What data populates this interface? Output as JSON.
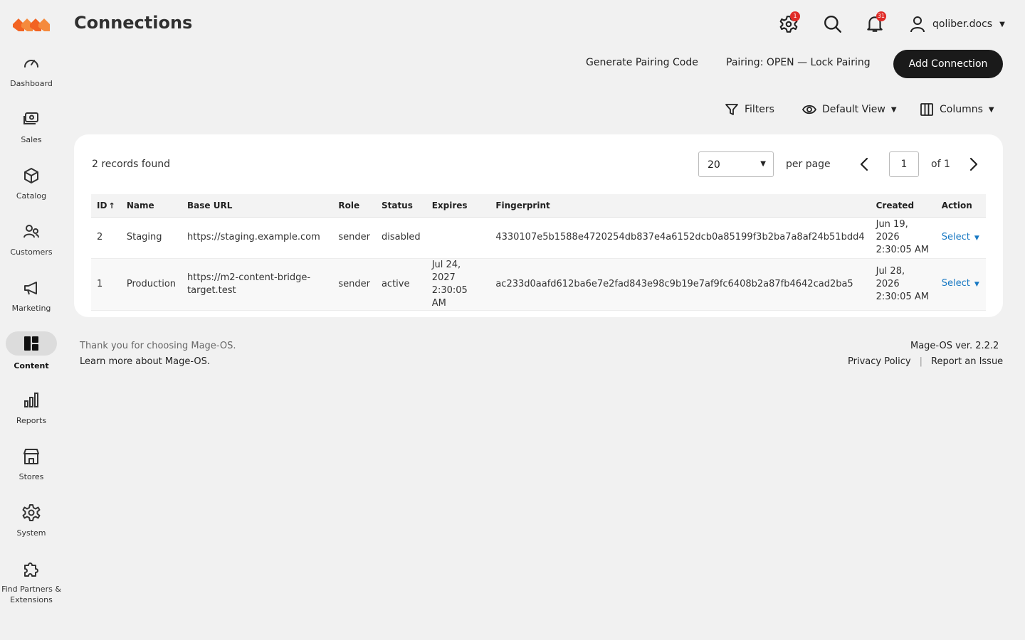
{
  "sidebar": {
    "logo": "mage-os-logo",
    "brand_color": "#f26322",
    "items": [
      {
        "label": "Dashboard",
        "icon": "speedometer-icon"
      },
      {
        "label": "Sales",
        "icon": "cash-icon"
      },
      {
        "label": "Catalog",
        "icon": "box-icon"
      },
      {
        "label": "Customers",
        "icon": "customers-icon"
      },
      {
        "label": "Marketing",
        "icon": "megaphone-icon"
      },
      {
        "label": "Content",
        "icon": "content-grid-icon",
        "active": true
      },
      {
        "label": "Reports",
        "icon": "bar-chart-icon"
      },
      {
        "label": "Stores",
        "icon": "storefront-icon"
      },
      {
        "label": "System",
        "icon": "gear-icon"
      },
      {
        "label": "Find Partners & Extensions",
        "icon": "puzzle-icon"
      }
    ]
  },
  "header": {
    "title": "Connections",
    "system_messages_count": "1",
    "notifications_count": "31",
    "user_name": "qoliber.docs"
  },
  "actions": {
    "generate_pairing": "Generate Pairing Code",
    "lock_pairing": "Pairing: OPEN — Lock Pairing",
    "add_connection": "Add Connection"
  },
  "toolbar": {
    "filters": "Filters",
    "view": "Default View",
    "columns": "Columns"
  },
  "grid": {
    "records_found": "2 records found",
    "per_page_value": "20",
    "per_page_label": "per page",
    "current_page": "1",
    "page_of": "of 1",
    "columns": [
      "ID",
      "Name",
      "Base URL",
      "Role",
      "Status",
      "Expires",
      "Fingerprint",
      "Created",
      "Action"
    ],
    "rows": [
      {
        "id": "2",
        "name": "Staging",
        "base_url": "https://staging.example.com",
        "role": "sender",
        "status": "disabled",
        "expires_date": "",
        "expires_time": "",
        "fingerprint": "4330107e5b1588e4720254db837e4a6152dcb0a85199f3b2ba7a8af24b51bdd4",
        "created_date": "Jun 19, 2026",
        "created_time": "2:30:05 AM",
        "action": "Select"
      },
      {
        "id": "1",
        "name": "Production",
        "base_url_line1": "https://m2-content-bridge-",
        "base_url_line2": "target.test",
        "role": "sender",
        "status": "active",
        "expires_date": "Jul 24, 2027",
        "expires_time": "2:30:05 AM",
        "fingerprint": "ac233d0aafd612ba6e7e2fad843e98c9b19e7af9fc6408b2a87fb4642cad2ba5",
        "created_date": "Jul 28, 2026",
        "created_time": "2:30:05 AM",
        "action": "Select"
      }
    ],
    "link_color": "#1979c3"
  },
  "footer": {
    "thanks": "Thank you for choosing Mage-OS.",
    "learn_more": "Learn more about Mage-OS.",
    "version": "Mage-OS ver. 2.2.2",
    "privacy": "Privacy Policy",
    "report_issue": "Report an Issue"
  }
}
